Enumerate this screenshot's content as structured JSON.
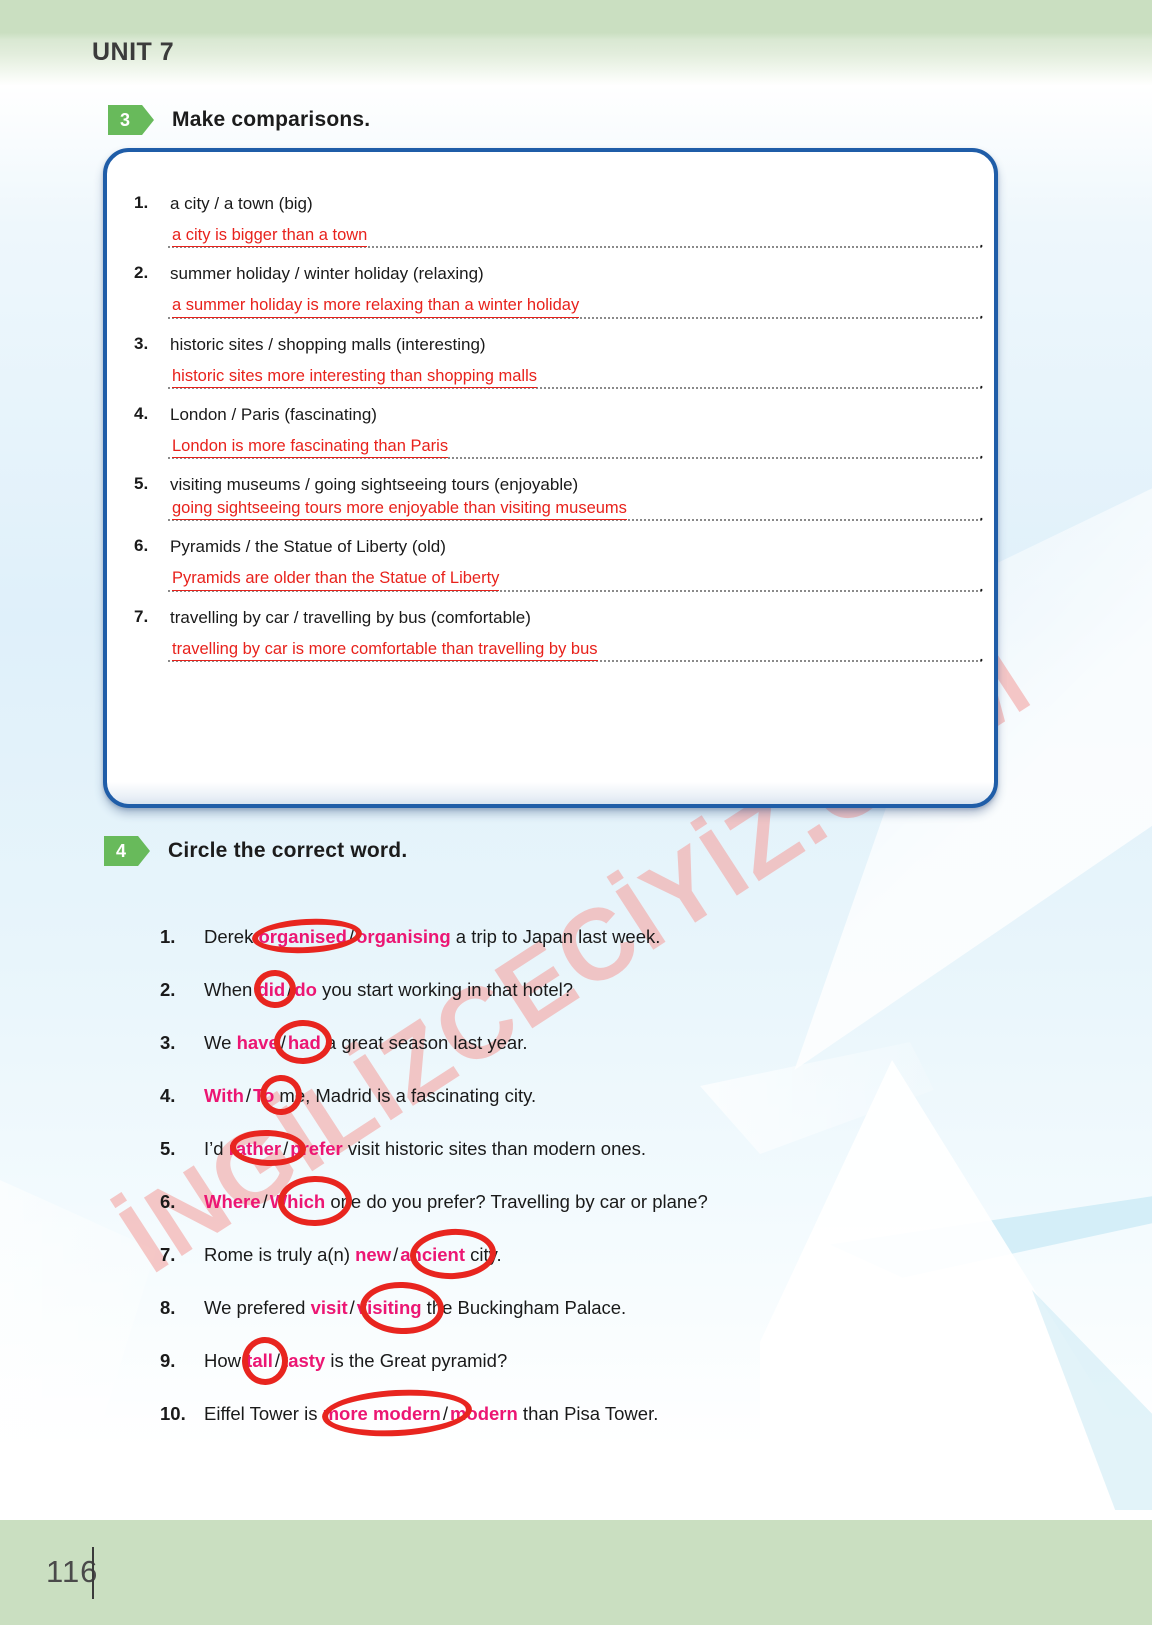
{
  "header": {
    "unit_title": "UNIT 7"
  },
  "footer": {
    "page_number": "116"
  },
  "watermark": {
    "text": "İNGİLİZCECİYİZ.COM"
  },
  "exercise3": {
    "number": "3",
    "title": "Make comparisons.",
    "items": [
      {
        "num": "1.",
        "prompt": "a city / a town (big)",
        "answer": "a city is bigger than a town",
        "end": "."
      },
      {
        "num": "2.",
        "prompt": "summer holiday / winter holiday (relaxing)",
        "answer": "a summer holiday is more relaxing than a winter holiday",
        "end": "."
      },
      {
        "num": "3.",
        "prompt": "historic sites / shopping malls (interesting)",
        "answer": "historic sites more interesting than shopping malls",
        "end": "."
      },
      {
        "num": "4.",
        "prompt": "London / Paris (fascinating)",
        "answer": "London is more fascinating than Paris",
        "end": "."
      },
      {
        "num": "5.",
        "prompt": "visiting museums / going sightseeing tours (enjoyable)",
        "answer": "going sightseeing tours more enjoyable than visiting museums",
        "end": "."
      },
      {
        "num": "6.",
        "prompt": "Pyramids / the Statue of Liberty (old)",
        "answer": "Pyramids are older than the Statue of Liberty",
        "end": "."
      },
      {
        "num": "7.",
        "prompt": "travelling by car / travelling by bus (comfortable)",
        "answer": "travelling by car is more comfortable than travelling by bus",
        "end": "."
      }
    ]
  },
  "exercise4": {
    "number": "4",
    "title": "Circle the correct word.",
    "separator": "/",
    "items": [
      {
        "num": "1.",
        "before": "Derek ",
        "option_a": "organised",
        "option_b": "organising",
        "after": " a trip to Japan last week.",
        "circled": "a"
      },
      {
        "num": "2.",
        "before": "When ",
        "option_a": "did",
        "option_b": "do",
        "after": " you start working in that hotel?",
        "circled": "a"
      },
      {
        "num": "3.",
        "before": "We ",
        "option_a": "have",
        "option_b": "had",
        "after": " a great season last year.",
        "circled": "b"
      },
      {
        "num": "4.",
        "before": "",
        "option_a": "With",
        "option_b": "To",
        "after": " me, Madrid is a fascinating city.",
        "circled": "b"
      },
      {
        "num": "5.",
        "before": "I’d ",
        "option_a": "rather",
        "option_b": "prefer",
        "after": " visit historic sites than modern ones.",
        "circled": "a"
      },
      {
        "num": "6.",
        "before": "",
        "option_a": "Where",
        "option_b": "Which",
        "after": " one do you prefer? Travelling by car or plane?",
        "circled": "b"
      },
      {
        "num": "7.",
        "before": "Rome is truly a(n) ",
        "option_a": "new",
        "option_b": "ancient",
        "after": " city.",
        "circled": "b"
      },
      {
        "num": "8.",
        "before": "We prefered ",
        "option_a": "visit",
        "option_b": "visiting",
        "after": " the Buckingham Palace.",
        "circled": "b"
      },
      {
        "num": "9.",
        "before": "How ",
        "option_a": "tall",
        "option_b": "tasty",
        "after": " is the Great pyramid?",
        "circled": "a"
      },
      {
        "num": "10.",
        "before": "Eiffel Tower is ",
        "option_a": "more modern",
        "option_b": "modern",
        "after": " than Pisa Tower.",
        "circled": "a"
      }
    ]
  },
  "colors": {
    "header_green": "#cadfc1",
    "badge_green": "#68ba5b",
    "box_blue": "#1f5da8",
    "answer_red": "#e8221c",
    "circle_red": "#e8251f",
    "keyword_pink": "#ec1673",
    "watermark_pink": "#f4a7a5"
  }
}
